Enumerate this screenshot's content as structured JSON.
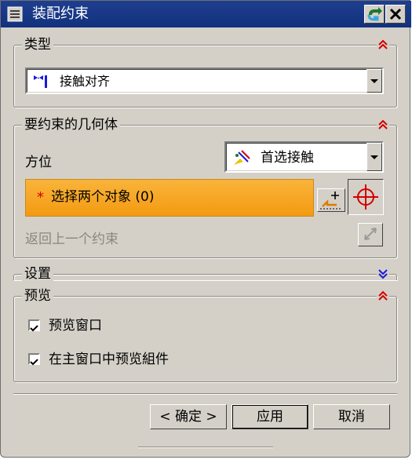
{
  "window": {
    "title": "装配约束",
    "icons": [
      "menu-icon",
      "return-icon",
      "close-icon"
    ]
  },
  "type_group": {
    "label": "类型",
    "selected": "接触对齐",
    "icon": "touch-align-icon"
  },
  "geometry_group": {
    "label": "要约束的几何体",
    "orientation_label": "方位",
    "orientation_value": "首选接触",
    "orientation_icon": "preferred-touch-icon",
    "select_prompt": "选择两个对象 (0)",
    "required_marker": "*",
    "back_label": "返回上一个约束"
  },
  "settings_group": {
    "label": "设置"
  },
  "preview_group": {
    "label": "预览",
    "options": [
      {
        "label": "预览窗口",
        "checked": true
      },
      {
        "label": "在主窗口中预览組件",
        "checked": true
      }
    ]
  },
  "buttons": {
    "ok": "< 确定 >",
    "apply": "应用",
    "cancel": "取消"
  },
  "colors": {
    "titlebar": "#12307d",
    "highlight": "#f7a21c",
    "dialog_bg": "#d4d0c8",
    "accent_red": "#d40000",
    "accent_blue": "#1a1ad8"
  }
}
